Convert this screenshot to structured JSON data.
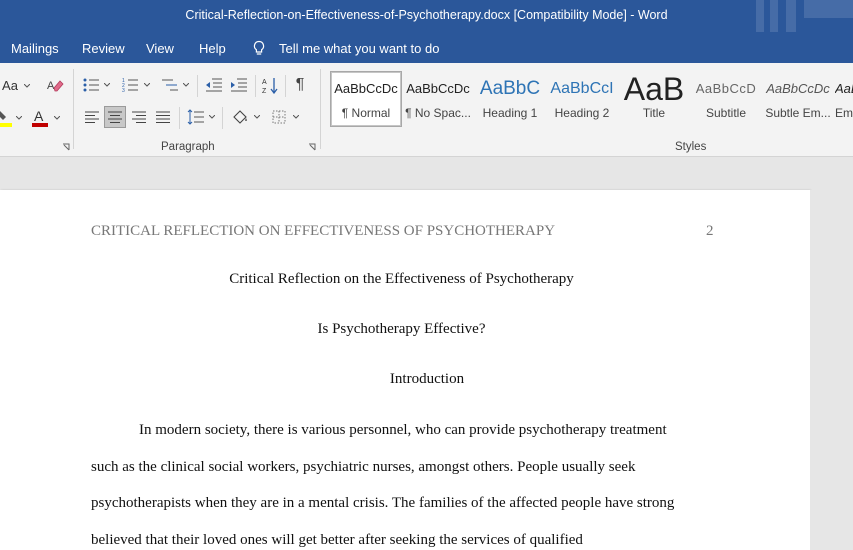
{
  "window": {
    "title": "Critical-Reflection-on-Effectiveness-of-Psychotherapy.docx [Compatibility Mode]  -  Word"
  },
  "menu": {
    "tabs": [
      "Mailings",
      "Review",
      "View",
      "Help"
    ],
    "tell_me": "Tell me what you want to do"
  },
  "ribbon": {
    "font_group": {
      "change_case": "Aa",
      "font_color": "#c00000",
      "highlight_color": "#ffff00"
    },
    "paragraph_label": "Paragraph",
    "styles_label": "Styles",
    "styles": [
      {
        "preview": "AaBbCcDc",
        "name": "¶ Normal",
        "selected": true
      },
      {
        "preview": "AaBbCcDc",
        "name": "¶ No Spac..."
      },
      {
        "preview": "AaBbC",
        "name": "Heading 1"
      },
      {
        "preview": "AaBbCcI",
        "name": "Heading 2"
      },
      {
        "preview": "AaB",
        "name": "Title"
      },
      {
        "preview": "AaBbCcD",
        "name": "Subtitle"
      },
      {
        "preview": "AaBbCcDc",
        "name": "Subtle Em..."
      },
      {
        "preview": "AaB",
        "name": "Em"
      }
    ]
  },
  "document": {
    "running_head": "CRITICAL REFLECTION ON EFFECTIVENESS OF PSYCHOTHERAPY",
    "page_number": "2",
    "title": "Critical Reflection on the Effectiveness of Psychotherapy",
    "subtitle": "Is Psychotherapy Effective?",
    "section_heading": "Introduction",
    "body_lines": [
      "In modern society, there is various personnel, who can provide psychotherapy treatment",
      "such as the clinical social workers, psychiatric nurses, amongst others. People usually seek",
      "psychotherapists when they are in a mental crisis. The families of the affected people have strong",
      "believed that their loved ones will get better after seeking the services of qualified"
    ]
  },
  "colors": {
    "title_bar": "#2b579a",
    "ribbon": "#f3f3f3",
    "workspace": "#e6e6e6"
  }
}
